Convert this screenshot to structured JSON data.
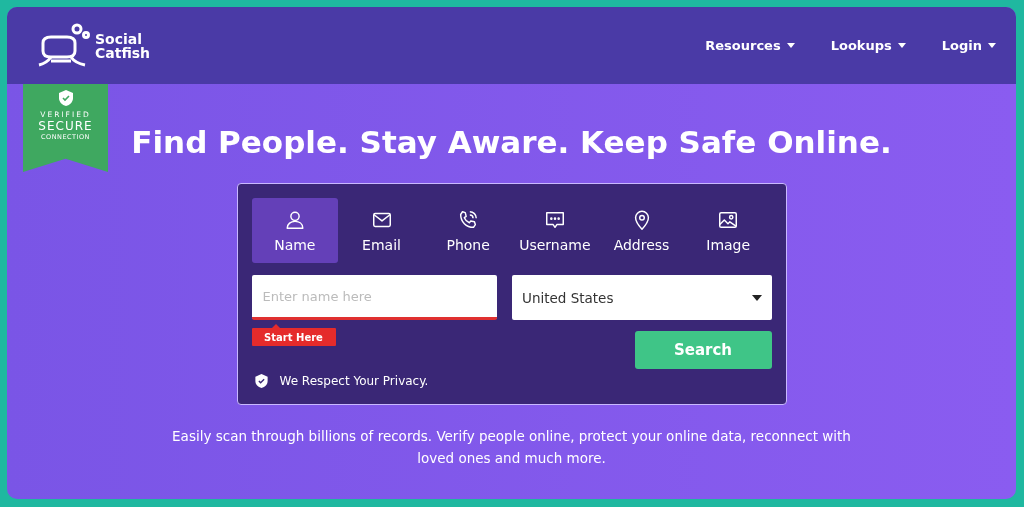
{
  "logo": {
    "line_1": "Social",
    "line_2": "Catfish"
  },
  "nav": [
    "Resources",
    "Lookups",
    "Login"
  ],
  "badge": {
    "line_1": "VERIFIED",
    "line_2": "SECURE",
    "line_3": "CONNECTION"
  },
  "headline": "Find People. Stay Aware. Keep Safe Online.",
  "tabs": [
    {
      "label": "Name",
      "selected": true
    },
    {
      "label": "Email",
      "selected": false
    },
    {
      "label": "Phone",
      "selected": false
    },
    {
      "label": "Username",
      "selected": false
    },
    {
      "label": "Address",
      "selected": false
    },
    {
      "label": "Image",
      "selected": false
    }
  ],
  "name_field": {
    "placeholder": "Enter name here"
  },
  "country": {
    "value": "United States"
  },
  "hint": "Start Here",
  "search_button": "Search",
  "privacy": "We Respect Your Privacy.",
  "description": "Easily scan through billions of records. Verify people online, protect your online data, reconnect with loved ones and much more."
}
